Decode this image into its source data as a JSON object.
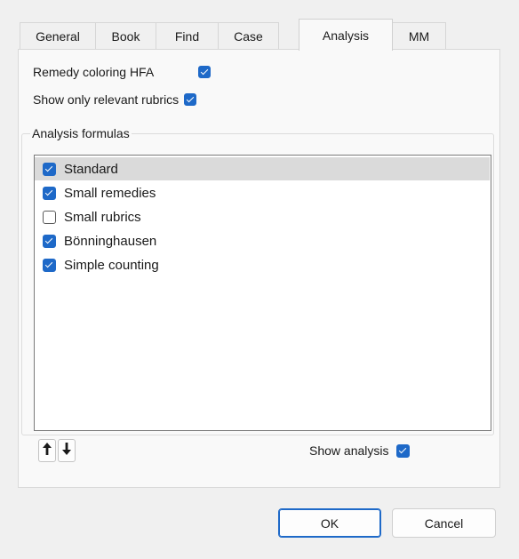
{
  "tabs": [
    "General",
    "Book",
    "Find",
    "Case",
    "Analysis",
    "MM"
  ],
  "active_tab": "Analysis",
  "options": {
    "remedy_coloring": {
      "label": "Remedy coloring HFA",
      "checked": true
    },
    "show_relevant": {
      "label": "Show only relevant rubrics",
      "checked": true
    }
  },
  "formulas": {
    "group_label": "Analysis formulas",
    "items": [
      {
        "label": "Standard",
        "checked": true,
        "selected": true
      },
      {
        "label": "Small remedies",
        "checked": true,
        "selected": false
      },
      {
        "label": "Small rubrics",
        "checked": false,
        "selected": false
      },
      {
        "label": "Bönninghausen",
        "checked": true,
        "selected": false
      },
      {
        "label": "Simple counting",
        "checked": true,
        "selected": false
      }
    ]
  },
  "controls": {
    "up_glyph": "🠕",
    "down_glyph": "🠗",
    "show_analysis": {
      "label": "Show analysis",
      "checked": true
    }
  },
  "buttons": {
    "ok": "OK",
    "cancel": "Cancel"
  },
  "colors": {
    "accent": "#1e69c8",
    "selection": "#dadada"
  }
}
